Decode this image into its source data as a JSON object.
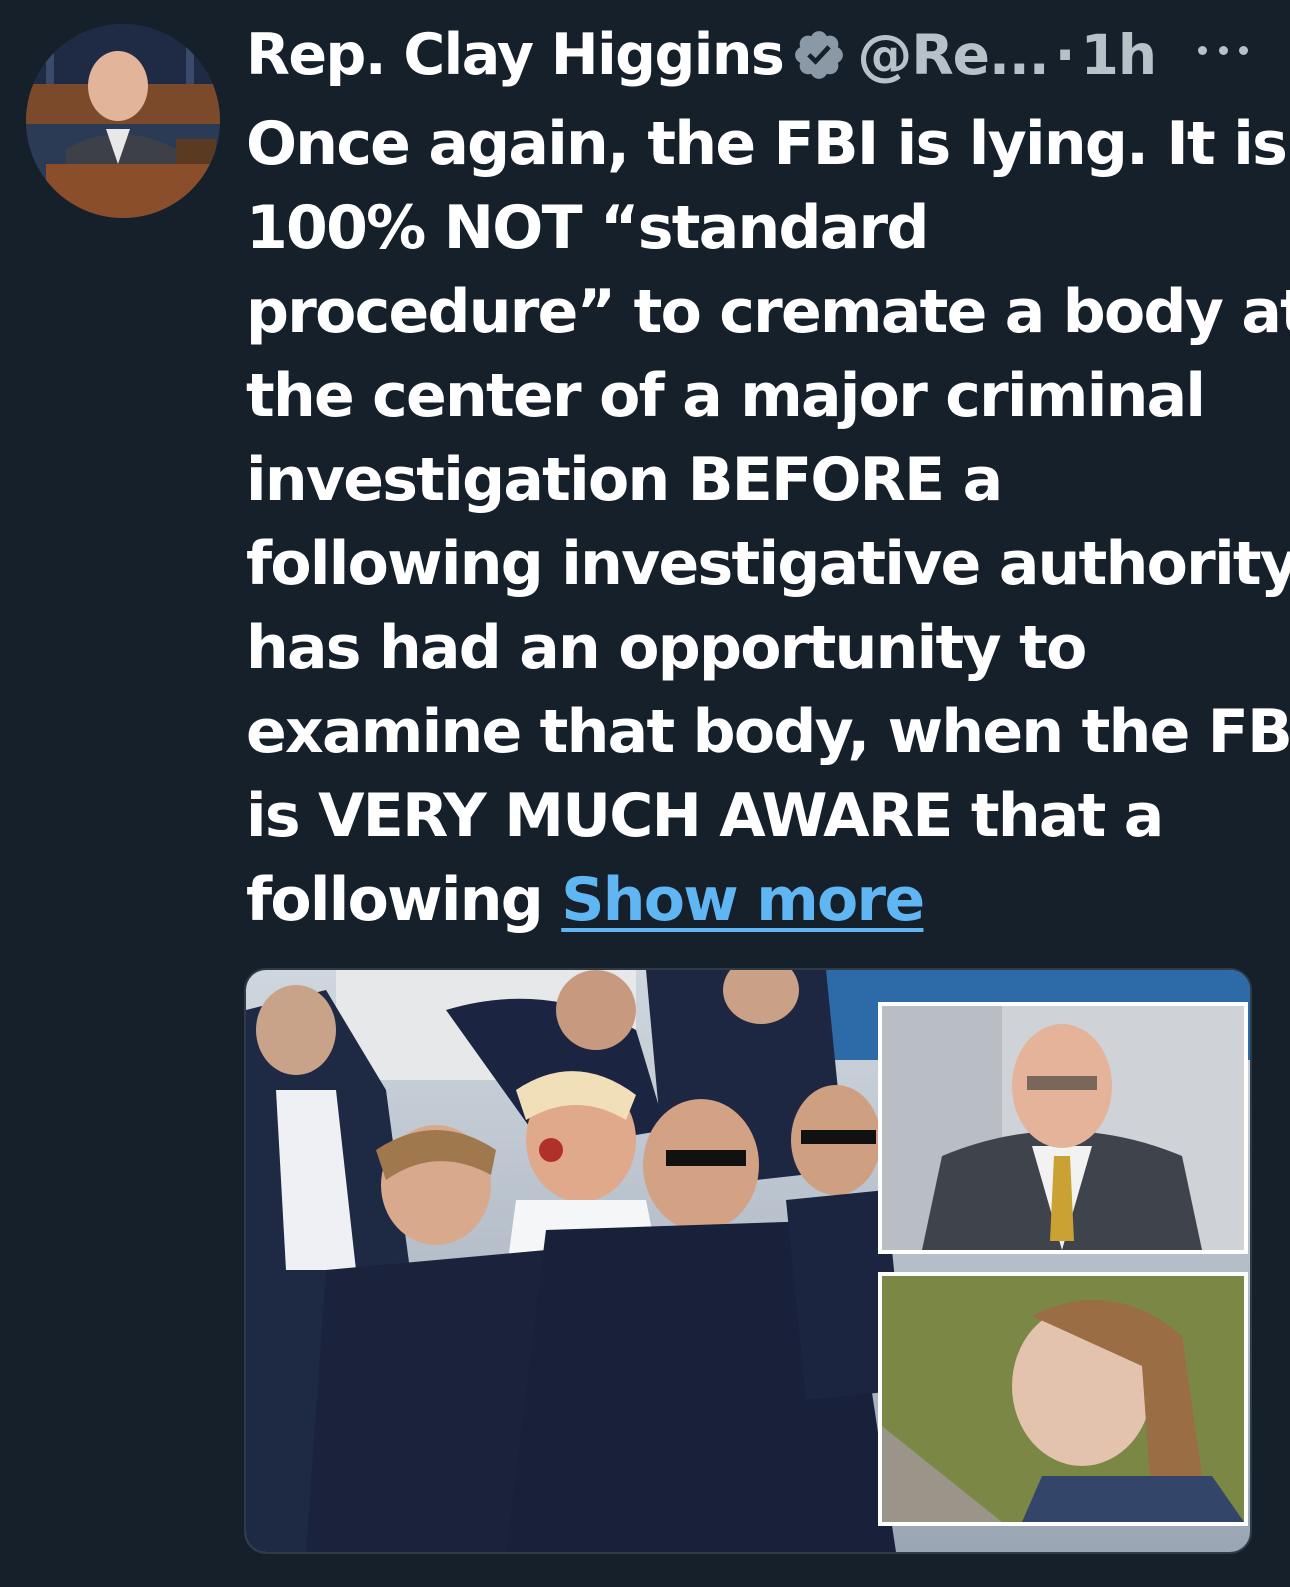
{
  "author": {
    "display_name": "Rep. Clay Higgins",
    "handle": "@Re...",
    "separator": "·",
    "time": "1h"
  },
  "icons": {
    "verified": "verified-badge-icon",
    "more": "more-options-icon"
  },
  "colors": {
    "background": "#16202a",
    "link": "#5fb6f2",
    "secondary_text": "#b8c0c8"
  },
  "tweet": {
    "lines": [
      "Once again, the FBI is lying. It is",
      "100% NOT “standard",
      "procedure” to cremate a body at",
      "the center of a major criminal",
      "investigation BEFORE a",
      "following investigative authority",
      "has had an opportunity to",
      "examine that body, when the FBI",
      "is VERY MUCH AWARE that a"
    ],
    "last_line": "following",
    "show_more": "Show more"
  }
}
